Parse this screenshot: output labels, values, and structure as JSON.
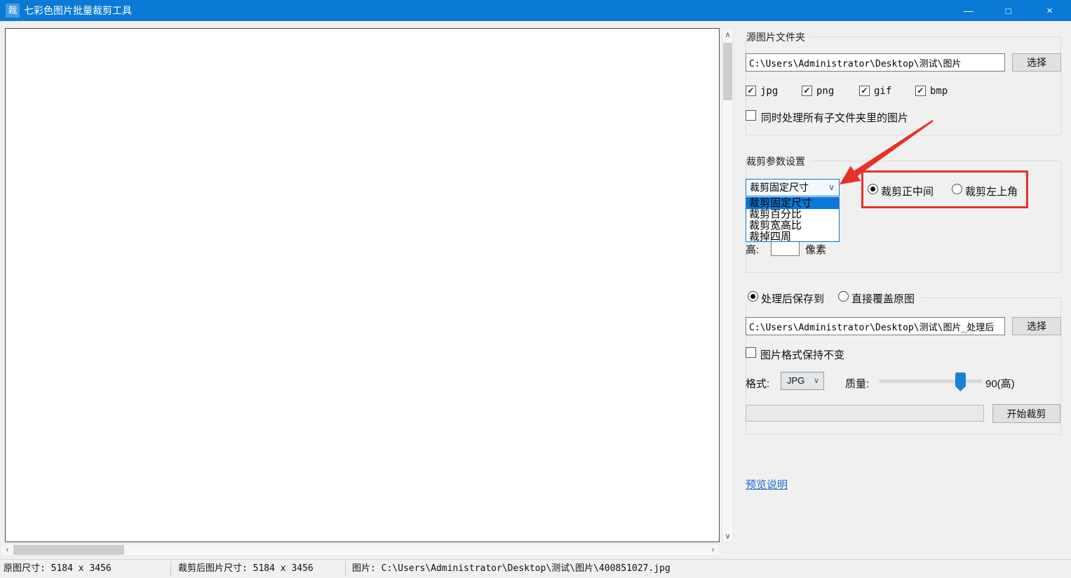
{
  "window": {
    "title": "七彩色图片批量裁剪工具",
    "icon_glyph": "裁"
  },
  "icons": {
    "minimize": "—",
    "maximize": "□",
    "close": "×",
    "chevron_down": "∨",
    "check": "✓",
    "scroll_up": "∧",
    "scroll_down": "∨",
    "scroll_left": "‹",
    "scroll_right": "›"
  },
  "colors": {
    "titlebar": "#0a7ad6",
    "accent_blue": "#0a78d6",
    "annotation_red": "#e8302a",
    "link_blue": "#1e6ccc"
  },
  "source_group": {
    "title": "源图片文件夹",
    "path_value": "C:\\Users\\Administrator\\Desktop\\测试\\图片",
    "select_button": "选择",
    "formats": [
      {
        "label": "jpg",
        "checked": true
      },
      {
        "label": "png",
        "checked": true
      },
      {
        "label": "gif",
        "checked": true
      },
      {
        "label": "bmp",
        "checked": true
      }
    ],
    "subfolders_checkbox": {
      "label": "同时处理所有子文件夹里的图片",
      "checked": false
    }
  },
  "crop_group": {
    "title": "裁剪参数设置",
    "mode_dropdown": {
      "value": "裁剪固定尺寸",
      "open": true,
      "selected_index": 0,
      "options": [
        "裁剪固定尺寸",
        "裁剪百分比",
        "裁剪宽高比",
        "裁掉四周"
      ]
    },
    "position_radios": [
      {
        "label": "裁剪正中间",
        "selected": true
      },
      {
        "label": "裁剪左上角",
        "selected": false
      }
    ],
    "height_field": {
      "label": "高:",
      "value": "",
      "unit": "像素"
    }
  },
  "save_group": {
    "radios": [
      {
        "label": "处理后保存到",
        "selected": true
      },
      {
        "label": "直接覆盖原图",
        "selected": false
      }
    ],
    "path_value": "C:\\Users\\Administrator\\Desktop\\测试\\图片_处理后",
    "select_button": "选择",
    "keep_format_checkbox": {
      "label": "图片格式保持不变",
      "checked": false
    },
    "format_field": {
      "label": "格式:",
      "value": "JPG"
    },
    "quality_field": {
      "label": "质量:",
      "value": 90,
      "display": "90(高)"
    },
    "start_button": "开始裁剪"
  },
  "preview_link": "预览说明",
  "statusbar": {
    "original_size": "原图尺寸: 5184 x 3456",
    "cropped_size": "裁剪后图片尺寸: 5184 x 3456",
    "image_path": "图片: C:\\Users\\Administrator\\Desktop\\测试\\图片\\400851027.jpg"
  }
}
